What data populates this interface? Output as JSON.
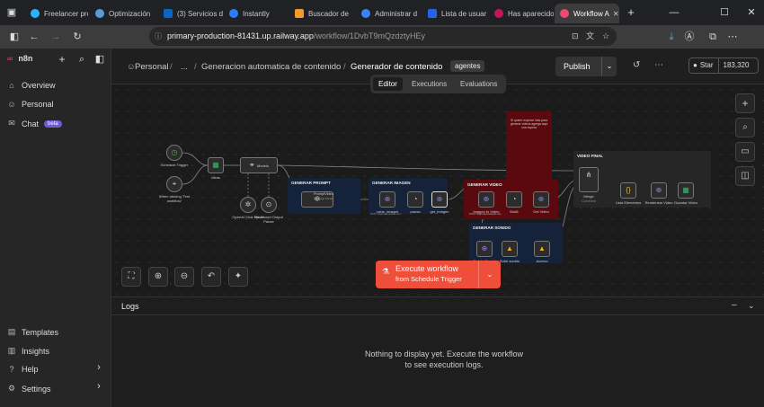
{
  "browser": {
    "tabs": [
      {
        "label": "Freelancer pro",
        "color": "#29b2fe"
      },
      {
        "label": "Optimización",
        "color": "#5b9bd5"
      },
      {
        "label": "(3) Servicios d",
        "color": "#0a66c2"
      },
      {
        "label": "Instantly",
        "color": "#2a7df7"
      },
      {
        "label": "Buscador de",
        "color": "#f29a2e"
      },
      {
        "label": "Administrar d",
        "color": "#3b82f6"
      },
      {
        "label": "Lista de usuar",
        "color": "#2563eb"
      },
      {
        "label": "Has aparecido",
        "color": "#c2185b"
      },
      {
        "label": "Workflow A",
        "color": "#ea4b71"
      }
    ],
    "new_tab": "+",
    "url_host": "primary-production-81431.up.railway.app",
    "url_path": "/workflow/1DvbT9mQzdztyHEy"
  },
  "sidebar": {
    "logo": "n8n",
    "items": [
      {
        "label": "Overview",
        "icon": "home-icon"
      },
      {
        "label": "Personal",
        "icon": "user-icon"
      },
      {
        "label": "Chat",
        "icon": "chat-icon",
        "badge": "beta"
      }
    ],
    "bottom": [
      {
        "label": "Templates",
        "icon": "templates-icon"
      },
      {
        "label": "Insights",
        "icon": "insights-icon"
      },
      {
        "label": "Help",
        "icon": "help-icon"
      },
      {
        "label": "Settings",
        "icon": "settings-icon"
      }
    ]
  },
  "header": {
    "crumb_personal": "Personal",
    "crumb_sep1": "/",
    "crumb_ellipsis": "...",
    "crumb_sep2": "/",
    "crumb_folder": "Generacion automatica de contenido",
    "crumb_sep3": "/",
    "workflow_name": "Generador de contenido",
    "tag": "agentes",
    "publish": "Publish",
    "star_label": "Star",
    "star_count": "183,320"
  },
  "modes": {
    "editor": "Editor",
    "executions": "Executions",
    "evaluations": "Evaluations",
    "active": "Editor"
  },
  "workflow": {
    "trigger1": "Schedule Trigger",
    "trigger2": "When clicking 'Test workflow'",
    "ideas": "Ideas",
    "model_node": "Modelo",
    "openai": "OpenAI Chat Model",
    "parser": "Structured Output Parser",
    "group_prompt": "GENERAR PROMPT",
    "prompt_node": "PromptVideo",
    "prompt_sub": "Message Model",
    "group_image": "GENERAR IMAGEN",
    "img1": "crear_imagen",
    "img1_sub": "POST: https://api.openai.com...",
    "img2": "pausa",
    "img3": "get_imagen",
    "group_video": "GENERAR VIDEO",
    "vid1": "Imagen to Video",
    "vid1_sub": "POST: https://api.example.com",
    "vid2": "Wait1",
    "vid3": "Get Video",
    "note": "Si quiere esperar más para generar videos agrega aqui una espera",
    "group_sound": "GENERAR SONIDO",
    "snd1": "Text to Sound",
    "snd2": "Subir sonido",
    "snd3": "Acceso",
    "group_final": "VIDEO FINAL",
    "merge": "Merge",
    "merge_sub": "Combine",
    "fin1": "Lista Elementos",
    "fin2": "Renderizar Video",
    "fin3": "Guardar Video"
  },
  "execute": {
    "label": "Execute workflow",
    "sub": "from Schedule Trigger"
  },
  "logs": {
    "title": "Logs",
    "message": "Nothing to display yet. Execute the workflow to see execution logs."
  },
  "colors": {
    "accent": "#ef4e3a",
    "group_blue": "#14233a",
    "group_red": "#5a0a0f",
    "bg": "#1b1b1b"
  }
}
